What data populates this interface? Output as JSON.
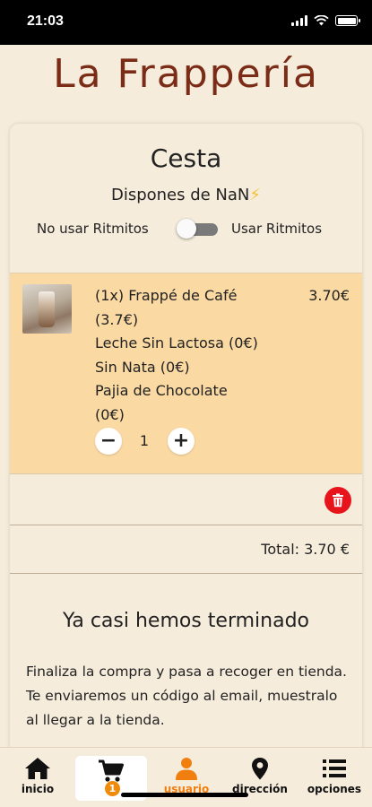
{
  "status_bar": {
    "time": "21:03"
  },
  "header": {
    "brand": "La Frappería"
  },
  "cart": {
    "title": "Cesta",
    "balance_prefix": "Dispones de NaN",
    "balance_icon": "⚡",
    "toggle_off_label": "No usar Ritmitos",
    "toggle_on_label": "Usar Ritmitos",
    "toggle_state": "off"
  },
  "item": {
    "lines": [
      "(1x) Frappé de Café",
      "(3.7€)",
      "Leche Sin Lactosa (0€)",
      "Sin Nata (0€)",
      "Pajia de Chocolate",
      "(0€)"
    ],
    "price": "3.70€",
    "quantity": "1",
    "minus_label": "−",
    "plus_label": "+"
  },
  "total": {
    "label": "Total: 3.70 €"
  },
  "finish": {
    "title": "Ya casi hemos terminado",
    "body": "Finaliza la compra y pasa a recoger en tienda. Te enviaremos un código al email, muestralo al llegar a la tienda."
  },
  "nav": {
    "items": [
      {
        "label": "inicio",
        "icon": "home-icon"
      },
      {
        "label": "",
        "icon": "cart-icon",
        "badge": "1"
      },
      {
        "label": "usuario",
        "icon": "user-icon"
      },
      {
        "label": "dirección",
        "icon": "location-pin-icon"
      },
      {
        "label": "opciones",
        "icon": "list-icon"
      }
    ]
  },
  "colors": {
    "brand": "#7a2c16",
    "background": "#f6ecdc",
    "item_highlight": "#fad9a3",
    "delete": "#e8141b",
    "accent_orange": "#f07f10"
  }
}
